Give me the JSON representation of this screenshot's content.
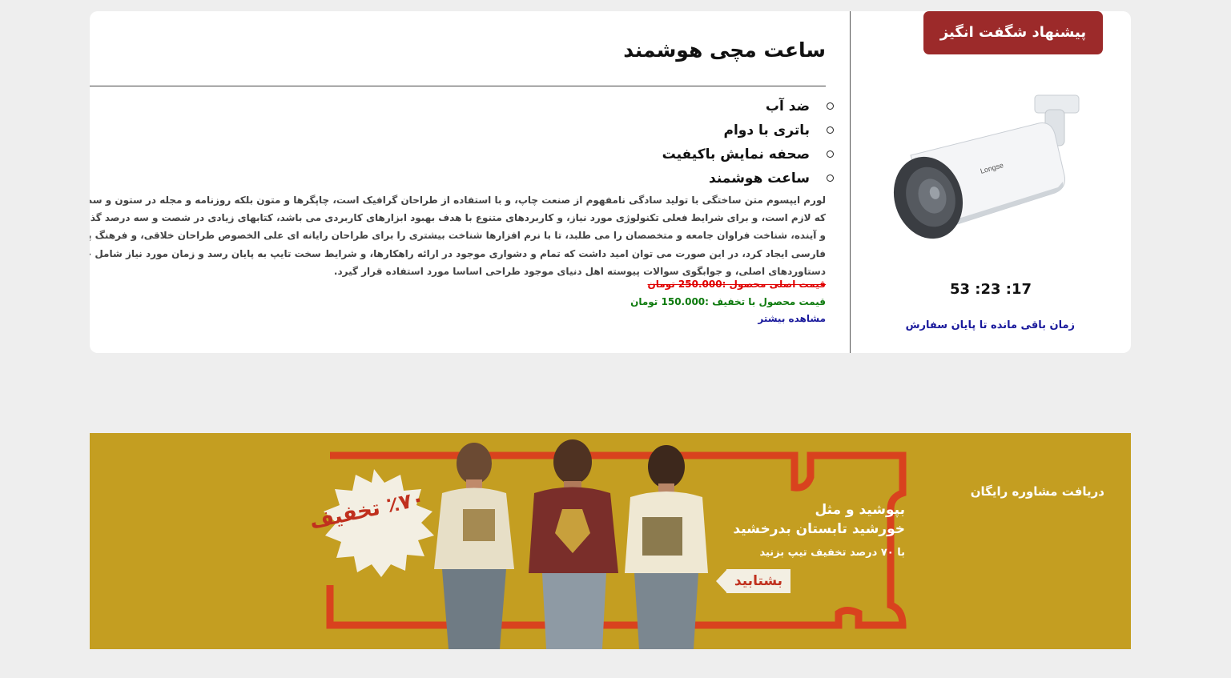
{
  "offer": {
    "badge": "پیشنهاد شگفت انگیز",
    "countdown": "53 :23 :17",
    "remaining_label": "زمان باقی مانده تا پایان سفارش",
    "image": "security-camera-image"
  },
  "product": {
    "title": "ساعت مچی هوشمند",
    "features": [
      "ضد آب",
      "باتری با دوام",
      "صحفه نمایش باکیفیت",
      "ساعت هوشمند"
    ],
    "description_lines": [
      "لورم ایپسوم متن ساختگی با تولید سادگی نامفهوم از صنعت چاپ، و با استفاده از طراحان گرافیک است، چاپگرها و متون بلکه روزنامه و مجله در ستون و سطرآنچنا",
      "که لازم است، و برای شرایط فعلی تکنولوژی مورد نیاز، و کاربردهای متنوع با هدف بهبود ابزارهای کاربردی می باشد، کتابهای زیادی در شصت و سه درصد گذشته حا",
      "و آینده، شناخت فراوان جامعه و متخصصان را می طلبد، تا با نرم افزارها شناخت بیشتری را برای طراحان رایانه ای علی الخصوص طراحان خلاقی، و فرهنگ پیشرو در ز",
      "فارسی ایجاد کرد، در این صورت می توان امید داشت که تمام و دشواری موجود در ارائه راهکارها، و شرایط سخت تایپ به پایان رسد و زمان مورد نیاز شامل حروفچ",
      "دستاوردهای اصلی، و جوابگوی سوالات پیوسته اهل دنیای موجود طراحی اساسا مورد استفاده قرار گیرد."
    ],
    "price_original": "قیمت اصلی محصول :250.000 تومان",
    "price_discount": "قیمت محصول با تخفیف :150.000 تومان",
    "see_more": "مشاهده بیشتر"
  },
  "banner": {
    "consult": "دریافت مشاوره رایگان",
    "slogan_line1": "بپوشید و مثل",
    "slogan_line2": "خورشید تابستان بدرخشید",
    "slogan_line3": "با ۷۰ درصد تخفیف تیپ بزنید",
    "hurry_button": "بشتابید",
    "discount_burst": "٪۷۰ تخفیف",
    "colors": {
      "background": "#c9a325",
      "frame": "#d9421e",
      "accent": "#c0301e"
    }
  }
}
